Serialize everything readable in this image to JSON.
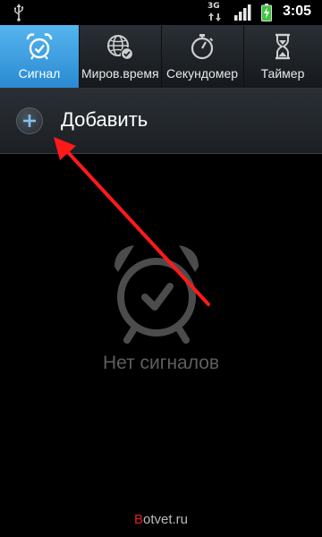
{
  "status_bar": {
    "time": "3:05",
    "network_label": "3G",
    "icons": [
      "usb-icon",
      "3g-data-icon",
      "signal-strength-icon",
      "battery-charging-icon"
    ]
  },
  "tabs": [
    {
      "label": "Сигнал",
      "icon": "alarm-clock-icon",
      "active": true
    },
    {
      "label": "Миров.время",
      "icon": "world-clock-icon",
      "active": false
    },
    {
      "label": "Секундомер",
      "icon": "stopwatch-icon",
      "active": false
    },
    {
      "label": "Таймер",
      "icon": "hourglass-icon",
      "active": false
    }
  ],
  "add_row": {
    "label": "Добавить",
    "icon": "plus-icon"
  },
  "empty_state": {
    "message": "Нет сигналов",
    "icon": "alarm-clock-icon"
  },
  "watermark": {
    "first_letter": "B",
    "rest": "otvet.ru"
  },
  "colors": {
    "active_tab": "#3fa0e0",
    "annotation_arrow": "#ff1a1a",
    "empty_text": "#5e5e5e"
  }
}
